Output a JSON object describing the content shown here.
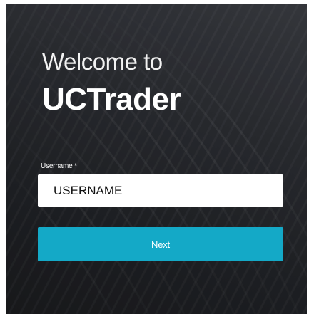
{
  "login": {
    "welcome_line": "Welcome to",
    "brand_name": "UCTrader",
    "username_label": "Username *",
    "username_value": "USERNAME",
    "next_label": "Next"
  },
  "colors": {
    "background": "#26282c",
    "accent": "#14a9c7",
    "text": "#ffffff"
  }
}
